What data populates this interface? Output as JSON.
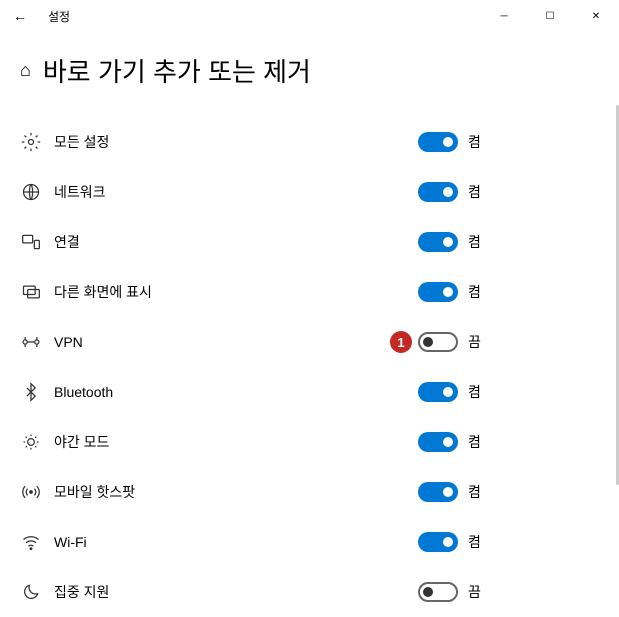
{
  "titlebar": {
    "back_glyph": "←",
    "app_title": "설정",
    "minimize": "─",
    "maximize": "☐",
    "close": "✕"
  },
  "header": {
    "home_glyph": "⌂",
    "title": "바로 가기 추가 또는 제거"
  },
  "toggle_labels": {
    "on": "켬",
    "off": "끔"
  },
  "items": [
    {
      "icon": "settings-gear-icon",
      "label": "모든 설정",
      "state": true
    },
    {
      "icon": "network-globe-icon",
      "label": "네트워크",
      "state": true
    },
    {
      "icon": "connect-devices-icon",
      "label": "연결",
      "state": true
    },
    {
      "icon": "project-screen-icon",
      "label": "다른 화면에 표시",
      "state": true
    },
    {
      "icon": "vpn-shield-icon",
      "label": "VPN",
      "state": false,
      "badge": "1"
    },
    {
      "icon": "bluetooth-icon",
      "label": "Bluetooth",
      "state": true
    },
    {
      "icon": "night-light-icon",
      "label": "야간 모드",
      "state": true
    },
    {
      "icon": "hotspot-icon",
      "label": "모바일 핫스팟",
      "state": true
    },
    {
      "icon": "wifi-icon",
      "label": "Wi-Fi",
      "state": true
    },
    {
      "icon": "focus-assist-icon",
      "label": "집중 지원",
      "state": false
    }
  ]
}
